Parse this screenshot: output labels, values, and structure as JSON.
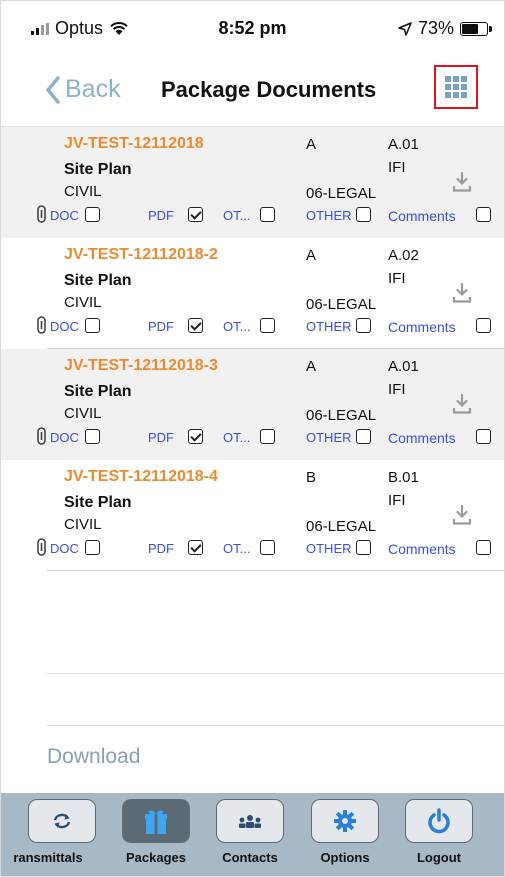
{
  "status_bar": {
    "carrier": "Optus",
    "time": "8:52 pm",
    "battery": "73%",
    "battery_level": 0.73
  },
  "nav": {
    "back_label": "Back",
    "title": "Package Documents"
  },
  "documents": [
    {
      "id": "JV-TEST-12112018",
      "title": "Site Plan",
      "discipline": "CIVIL",
      "revision": "A",
      "version": "A.01",
      "status": "IFI",
      "code": "06-LEGAL",
      "doc": false,
      "pdf": true,
      "ot": false,
      "other": false,
      "comments": false
    },
    {
      "id": "JV-TEST-12112018-2",
      "title": "Site Plan",
      "discipline": "CIVIL",
      "revision": "A",
      "version": "A.02",
      "status": "IFI",
      "code": "06-LEGAL",
      "doc": false,
      "pdf": true,
      "ot": false,
      "other": false,
      "comments": false
    },
    {
      "id": "JV-TEST-12112018-3",
      "title": "Site Plan",
      "discipline": "CIVIL",
      "revision": "A",
      "version": "A.01",
      "status": "IFI",
      "code": "06-LEGAL",
      "doc": false,
      "pdf": true,
      "ot": false,
      "other": false,
      "comments": false
    },
    {
      "id": "JV-TEST-12112018-4",
      "title": "Site Plan",
      "discipline": "CIVIL",
      "revision": "B",
      "version": "B.01",
      "status": "IFI",
      "code": "06-LEGAL",
      "doc": false,
      "pdf": true,
      "ot": false,
      "other": false,
      "comments": false
    }
  ],
  "checkbox_labels": {
    "doc": "DOC",
    "pdf": "PDF",
    "ot": "OT...",
    "other": "OTHER",
    "comments": "Comments"
  },
  "download_label": "Download",
  "tabs": [
    {
      "label": "ransmittals",
      "icon": "refresh-icon",
      "active": false
    },
    {
      "label": "Packages",
      "icon": "gift-icon",
      "active": true
    },
    {
      "label": "Contacts",
      "icon": "people-icon",
      "active": false
    },
    {
      "label": "Options",
      "icon": "gear-icon",
      "active": false
    },
    {
      "label": "Logout",
      "icon": "power-icon",
      "active": false
    }
  ],
  "colors": {
    "doc_id": "#ee8a2e",
    "checkbox_label": "#3a4fe0",
    "highlight_border": "#e0121b",
    "tabbar": "#a7b9c7",
    "active_tab": "#5c6a75",
    "back": "#8fb0cc"
  }
}
